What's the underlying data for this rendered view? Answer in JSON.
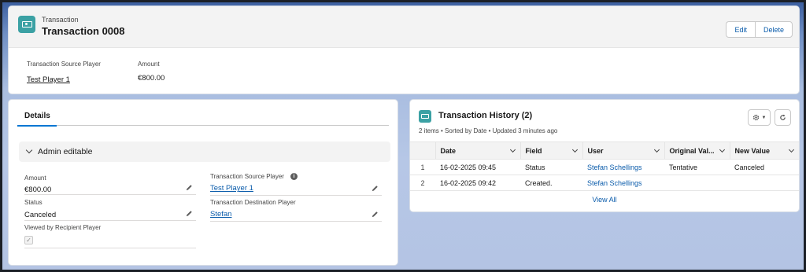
{
  "record": {
    "object_type": "Transaction",
    "title": "Transaction 0008",
    "actions": [
      "Edit",
      "Delete"
    ]
  },
  "highlights": [
    {
      "label": "Transaction Source Player",
      "value": "Test Player 1",
      "is_link": true
    },
    {
      "label": "Amount",
      "value": "€800.00",
      "is_link": false
    }
  ],
  "details": {
    "tab_label": "Details",
    "section_title": "Admin editable",
    "fields": {
      "amount": {
        "label": "Amount",
        "value": "€800.00"
      },
      "status": {
        "label": "Status",
        "value": "Canceled"
      },
      "viewed": {
        "label": "Viewed by Recipient Player",
        "checked": true
      },
      "source_player": {
        "label": "Transaction Source Player",
        "value": "Test Player 1"
      },
      "destination_player": {
        "label": "Transaction Destination Player",
        "value": "Stefan"
      }
    }
  },
  "history": {
    "title": "Transaction History (2)",
    "subtitle": "2 items • Sorted by Date • Updated 3 minutes ago",
    "columns": [
      "Date",
      "Field",
      "User",
      "Original Val...",
      "New Value"
    ],
    "rows": [
      {
        "num": "1",
        "date": "16-02-2025 09:45",
        "field": "Status",
        "user": "Stefan Schellings",
        "original": "Tentative",
        "new": "Canceled"
      },
      {
        "num": "2",
        "date": "16-02-2025 09:42",
        "field": "Created.",
        "user": "Stefan Schellings",
        "original": "",
        "new": ""
      }
    ],
    "view_all": "View All"
  },
  "colors": {
    "accent": "#0176d3",
    "link": "#0b5cab",
    "object_icon": "#3ba1a4"
  },
  "icons": {
    "object": "money-icon",
    "settings": "gear-icon",
    "refresh": "refresh-icon",
    "edit": "pencil-icon",
    "info": "info-icon"
  }
}
